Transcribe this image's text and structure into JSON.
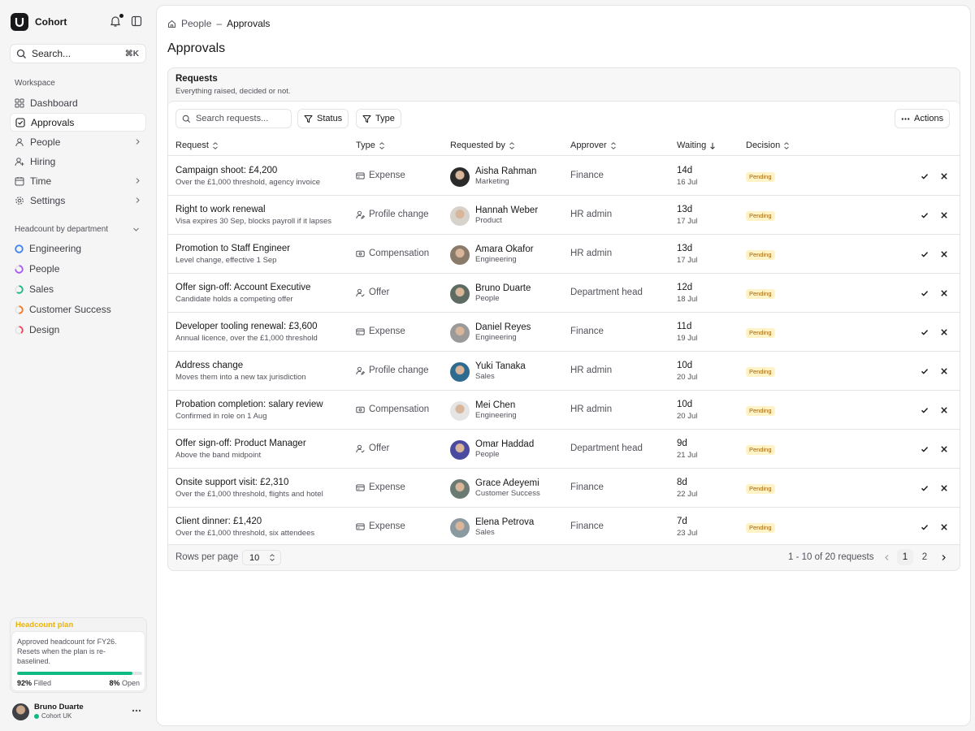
{
  "app": {
    "name": "Cohort"
  },
  "sidebar": {
    "search": {
      "placeholder": "Search...",
      "shortcut": "⌘K"
    },
    "workspace_label": "Workspace",
    "nav": [
      {
        "label": "Dashboard",
        "icon": "grid-icon",
        "active": false,
        "has_chevron": false
      },
      {
        "label": "Approvals",
        "icon": "check-square-icon",
        "active": true,
        "has_chevron": false
      },
      {
        "label": "People",
        "icon": "user-icon",
        "active": false,
        "has_chevron": true
      },
      {
        "label": "Hiring",
        "icon": "briefcase-icon",
        "active": false,
        "has_chevron": false
      },
      {
        "label": "Time",
        "icon": "calendar-icon",
        "active": false,
        "has_chevron": true
      },
      {
        "label": "Settings",
        "icon": "gear-icon",
        "active": false,
        "has_chevron": true
      }
    ],
    "headcount_label": "Headcount by department",
    "departments": [
      {
        "label": "Engineering",
        "color": "#3b82f6",
        "fraction": 1.0
      },
      {
        "label": "People",
        "color": "#a855f7",
        "fraction": 0.75
      },
      {
        "label": "Sales",
        "color": "#10b981",
        "fraction": 0.6
      },
      {
        "label": "Customer Success",
        "color": "#f97316",
        "fraction": 0.5
      },
      {
        "label": "Design",
        "color": "#f43f5e",
        "fraction": 0.4
      }
    ],
    "plan": {
      "title": "Headcount plan",
      "description": "Approved headcount for FY26. Resets when the plan is re-baselined.",
      "filled_pct": "92%",
      "filled_label": "Filled",
      "open_pct": "8%",
      "open_label": "Open",
      "filled_fraction": 0.92
    },
    "user": {
      "name": "Bruno Duarte",
      "org": "Cohort UK"
    }
  },
  "main": {
    "breadcrumb": {
      "parent": "People",
      "separator": "–",
      "current": "Approvals"
    },
    "title": "Approvals",
    "card": {
      "title": "Requests",
      "subtitle": "Everything raised, decided or not."
    },
    "toolbar": {
      "search_placeholder": "Search requests...",
      "status_label": "Status",
      "type_label": "Type",
      "actions_label": "Actions"
    },
    "columns": [
      "Request",
      "Type",
      "Requested by",
      "Approver",
      "Waiting",
      "Decision"
    ],
    "rows": [
      {
        "title": "Campaign shoot: £4,200",
        "desc": "Over the £1,000 threshold, agency invoice",
        "type": "Expense",
        "type_icon": "expense",
        "by": "Aisha Rahman",
        "dept": "Marketing",
        "approver": "Finance",
        "days": "14d",
        "date": "16 Jul",
        "decision": "Pending",
        "avatar": "#2a2a2a"
      },
      {
        "title": "Right to work renewal",
        "desc": "Visa expires 30 Sep, blocks payroll if it lapses",
        "type": "Profile change",
        "type_icon": "profile",
        "by": "Hannah Weber",
        "dept": "Product",
        "approver": "HR admin",
        "days": "13d",
        "date": "17 Jul",
        "decision": "Pending",
        "avatar": "#d8d2cc"
      },
      {
        "title": "Promotion to Staff Engineer",
        "desc": "Level change, effective 1 Sep",
        "type": "Compensation",
        "type_icon": "money",
        "by": "Amara Okafor",
        "dept": "Engineering",
        "approver": "HR admin",
        "days": "13d",
        "date": "17 Jul",
        "decision": "Pending",
        "avatar": "#8a7a6a"
      },
      {
        "title": "Offer sign-off: Account Executive",
        "desc": "Candidate holds a competing offer",
        "type": "Offer",
        "type_icon": "offer",
        "by": "Bruno Duarte",
        "dept": "People",
        "approver": "Department head",
        "days": "12d",
        "date": "18 Jul",
        "decision": "Pending",
        "avatar": "#5d6b62"
      },
      {
        "title": "Developer tooling renewal: £3,600",
        "desc": "Annual licence, over the £1,000 threshold",
        "type": "Expense",
        "type_icon": "expense",
        "by": "Daniel Reyes",
        "dept": "Engineering",
        "approver": "Finance",
        "days": "11d",
        "date": "19 Jul",
        "decision": "Pending",
        "avatar": "#9a9a9a"
      },
      {
        "title": "Address change",
        "desc": "Moves them into a new tax jurisdiction",
        "type": "Profile change",
        "type_icon": "profile",
        "by": "Yuki Tanaka",
        "dept": "Sales",
        "approver": "HR admin",
        "days": "10d",
        "date": "20 Jul",
        "decision": "Pending",
        "avatar": "#2f6b8f"
      },
      {
        "title": "Probation completion: salary review",
        "desc": "Confirmed in role on 1 Aug",
        "type": "Compensation",
        "type_icon": "money",
        "by": "Mei Chen",
        "dept": "Engineering",
        "approver": "HR admin",
        "days": "10d",
        "date": "20 Jul",
        "decision": "Pending",
        "avatar": "#e5e5e5"
      },
      {
        "title": "Offer sign-off: Product Manager",
        "desc": "Above the band midpoint",
        "type": "Offer",
        "type_icon": "offer",
        "by": "Omar Haddad",
        "dept": "People",
        "approver": "Department head",
        "days": "9d",
        "date": "21 Jul",
        "decision": "Pending",
        "avatar": "#4a4aa0"
      },
      {
        "title": "Onsite support visit: £2,310",
        "desc": "Over the £1,000 threshold, flights and hotel",
        "type": "Expense",
        "type_icon": "expense",
        "by": "Grace Adeyemi",
        "dept": "Customer Success",
        "approver": "Finance",
        "days": "8d",
        "date": "22 Jul",
        "decision": "Pending",
        "avatar": "#6b7a72"
      },
      {
        "title": "Client dinner: £1,420",
        "desc": "Over the £1,000 threshold, six attendees",
        "type": "Expense",
        "type_icon": "expense",
        "by": "Elena Petrova",
        "dept": "Sales",
        "approver": "Finance",
        "days": "7d",
        "date": "23 Jul",
        "decision": "Pending",
        "avatar": "#8a9aa0"
      }
    ],
    "footer": {
      "rows_per_page_label": "Rows per page",
      "rows_per_page_value": "10",
      "range": "1 - 10 of 20 requests",
      "pages": [
        "1",
        "2"
      ],
      "current_page": "1"
    }
  }
}
